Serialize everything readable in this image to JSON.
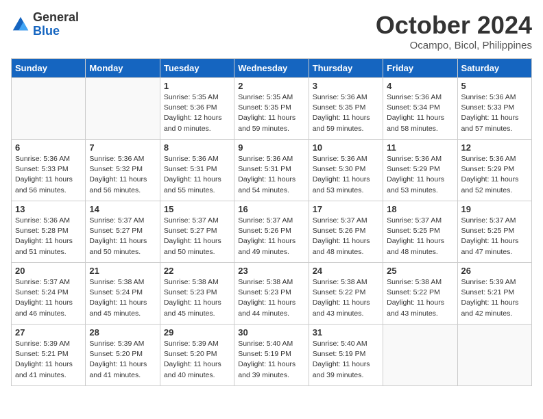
{
  "logo": {
    "general": "General",
    "blue": "Blue"
  },
  "title": "October 2024",
  "location": "Ocampo, Bicol, Philippines",
  "days_of_week": [
    "Sunday",
    "Monday",
    "Tuesday",
    "Wednesday",
    "Thursday",
    "Friday",
    "Saturday"
  ],
  "weeks": [
    [
      {
        "day": "",
        "info": ""
      },
      {
        "day": "",
        "info": ""
      },
      {
        "day": "1",
        "info": "Sunrise: 5:35 AM\nSunset: 5:36 PM\nDaylight: 12 hours\nand 0 minutes."
      },
      {
        "day": "2",
        "info": "Sunrise: 5:35 AM\nSunset: 5:35 PM\nDaylight: 11 hours\nand 59 minutes."
      },
      {
        "day": "3",
        "info": "Sunrise: 5:36 AM\nSunset: 5:35 PM\nDaylight: 11 hours\nand 59 minutes."
      },
      {
        "day": "4",
        "info": "Sunrise: 5:36 AM\nSunset: 5:34 PM\nDaylight: 11 hours\nand 58 minutes."
      },
      {
        "day": "5",
        "info": "Sunrise: 5:36 AM\nSunset: 5:33 PM\nDaylight: 11 hours\nand 57 minutes."
      }
    ],
    [
      {
        "day": "6",
        "info": "Sunrise: 5:36 AM\nSunset: 5:33 PM\nDaylight: 11 hours\nand 56 minutes."
      },
      {
        "day": "7",
        "info": "Sunrise: 5:36 AM\nSunset: 5:32 PM\nDaylight: 11 hours\nand 56 minutes."
      },
      {
        "day": "8",
        "info": "Sunrise: 5:36 AM\nSunset: 5:31 PM\nDaylight: 11 hours\nand 55 minutes."
      },
      {
        "day": "9",
        "info": "Sunrise: 5:36 AM\nSunset: 5:31 PM\nDaylight: 11 hours\nand 54 minutes."
      },
      {
        "day": "10",
        "info": "Sunrise: 5:36 AM\nSunset: 5:30 PM\nDaylight: 11 hours\nand 53 minutes."
      },
      {
        "day": "11",
        "info": "Sunrise: 5:36 AM\nSunset: 5:29 PM\nDaylight: 11 hours\nand 53 minutes."
      },
      {
        "day": "12",
        "info": "Sunrise: 5:36 AM\nSunset: 5:29 PM\nDaylight: 11 hours\nand 52 minutes."
      }
    ],
    [
      {
        "day": "13",
        "info": "Sunrise: 5:36 AM\nSunset: 5:28 PM\nDaylight: 11 hours\nand 51 minutes."
      },
      {
        "day": "14",
        "info": "Sunrise: 5:37 AM\nSunset: 5:27 PM\nDaylight: 11 hours\nand 50 minutes."
      },
      {
        "day": "15",
        "info": "Sunrise: 5:37 AM\nSunset: 5:27 PM\nDaylight: 11 hours\nand 50 minutes."
      },
      {
        "day": "16",
        "info": "Sunrise: 5:37 AM\nSunset: 5:26 PM\nDaylight: 11 hours\nand 49 minutes."
      },
      {
        "day": "17",
        "info": "Sunrise: 5:37 AM\nSunset: 5:26 PM\nDaylight: 11 hours\nand 48 minutes."
      },
      {
        "day": "18",
        "info": "Sunrise: 5:37 AM\nSunset: 5:25 PM\nDaylight: 11 hours\nand 48 minutes."
      },
      {
        "day": "19",
        "info": "Sunrise: 5:37 AM\nSunset: 5:25 PM\nDaylight: 11 hours\nand 47 minutes."
      }
    ],
    [
      {
        "day": "20",
        "info": "Sunrise: 5:37 AM\nSunset: 5:24 PM\nDaylight: 11 hours\nand 46 minutes."
      },
      {
        "day": "21",
        "info": "Sunrise: 5:38 AM\nSunset: 5:24 PM\nDaylight: 11 hours\nand 45 minutes."
      },
      {
        "day": "22",
        "info": "Sunrise: 5:38 AM\nSunset: 5:23 PM\nDaylight: 11 hours\nand 45 minutes."
      },
      {
        "day": "23",
        "info": "Sunrise: 5:38 AM\nSunset: 5:23 PM\nDaylight: 11 hours\nand 44 minutes."
      },
      {
        "day": "24",
        "info": "Sunrise: 5:38 AM\nSunset: 5:22 PM\nDaylight: 11 hours\nand 43 minutes."
      },
      {
        "day": "25",
        "info": "Sunrise: 5:38 AM\nSunset: 5:22 PM\nDaylight: 11 hours\nand 43 minutes."
      },
      {
        "day": "26",
        "info": "Sunrise: 5:39 AM\nSunset: 5:21 PM\nDaylight: 11 hours\nand 42 minutes."
      }
    ],
    [
      {
        "day": "27",
        "info": "Sunrise: 5:39 AM\nSunset: 5:21 PM\nDaylight: 11 hours\nand 41 minutes."
      },
      {
        "day": "28",
        "info": "Sunrise: 5:39 AM\nSunset: 5:20 PM\nDaylight: 11 hours\nand 41 minutes."
      },
      {
        "day": "29",
        "info": "Sunrise: 5:39 AM\nSunset: 5:20 PM\nDaylight: 11 hours\nand 40 minutes."
      },
      {
        "day": "30",
        "info": "Sunrise: 5:40 AM\nSunset: 5:19 PM\nDaylight: 11 hours\nand 39 minutes."
      },
      {
        "day": "31",
        "info": "Sunrise: 5:40 AM\nSunset: 5:19 PM\nDaylight: 11 hours\nand 39 minutes."
      },
      {
        "day": "",
        "info": ""
      },
      {
        "day": "",
        "info": ""
      }
    ]
  ]
}
